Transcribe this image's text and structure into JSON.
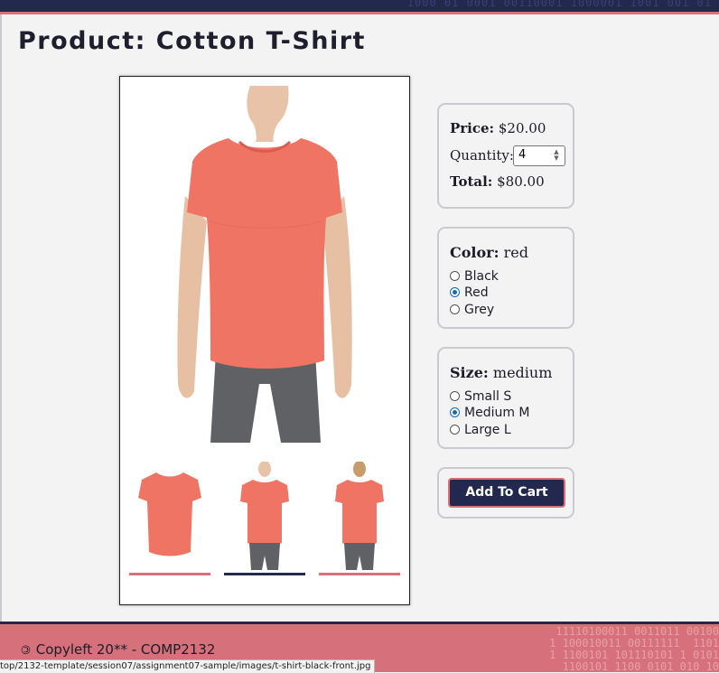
{
  "header": {
    "bits": "1000 01 0001 00110001 1000001 1001 001 01"
  },
  "page": {
    "title": "Product: Cotton T-Shirt"
  },
  "gallery": {
    "thumbnails": [
      {
        "name": "t-shirt-flat",
        "active": false
      },
      {
        "name": "t-shirt-front",
        "active": true
      },
      {
        "name": "t-shirt-back",
        "active": false
      }
    ]
  },
  "pricing": {
    "price_label": "Price:",
    "price_value": "$20.00",
    "quantity_label": "Quantity:",
    "quantity_value": "4",
    "total_label": "Total:",
    "total_value": "$80.00"
  },
  "color": {
    "label": "Color:",
    "selected": "red",
    "options": [
      "Black",
      "Red",
      "Grey"
    ],
    "selected_index": 1
  },
  "size": {
    "label": "Size:",
    "selected": "medium",
    "options": [
      "Small S",
      "Medium M",
      "Large L"
    ],
    "selected_index": 1
  },
  "cart": {
    "button_label": "Add To Cart"
  },
  "footer": {
    "copyleft": "Copyleft 20** - COMP2132",
    "bits": "  11110100011 0011011 00100\n1 100010011 00111111  1101\n1 1100101 101110101 1 0101\n  1100101 1100 0101 010 10"
  },
  "status_bar": {
    "url": "top/2132-template/session07/assignment07-sample/images/t-shirt-black-front.jpg"
  },
  "colors": {
    "navy": "#23284f",
    "coral": "#d6707a",
    "radio_accent": "#1565c0"
  }
}
